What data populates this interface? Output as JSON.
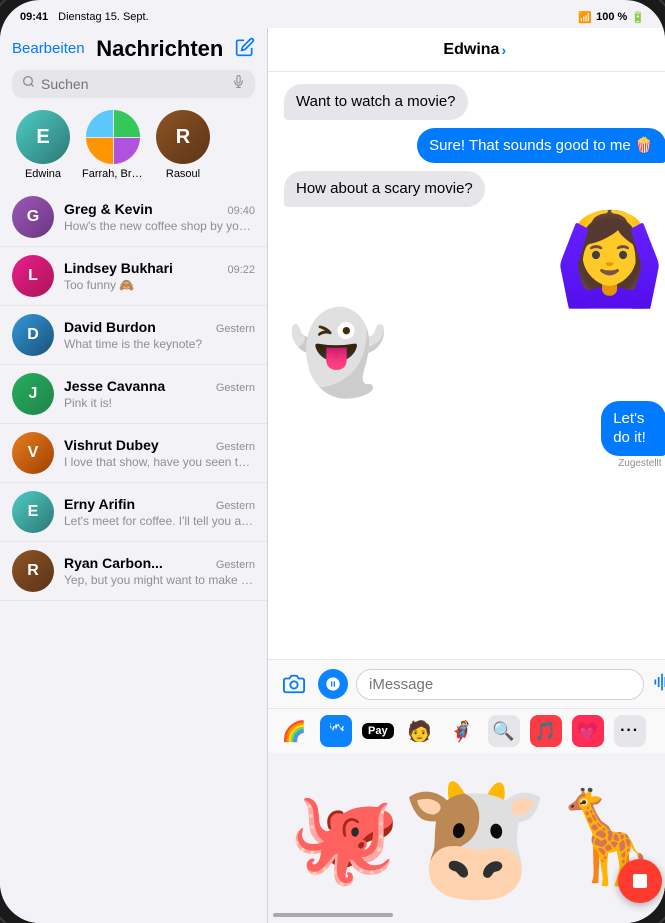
{
  "statusBar": {
    "time": "09:41",
    "date": "Dienstag 15. Sept.",
    "wifi": "WiFi",
    "battery": "100 %"
  },
  "sidebar": {
    "editLabel": "Bearbeiten",
    "title": "Nachrichten",
    "composeLabel": "✏",
    "search": {
      "placeholder": "Suchen"
    },
    "pinnedContacts": [
      {
        "id": "edwina",
        "name": "Edwina",
        "avatarColor": "av-teal",
        "initial": "E",
        "isGroup": false
      },
      {
        "id": "farrah-brya",
        "name": "Farrah, Brya...",
        "avatarColor": "",
        "initial": "",
        "isGroup": true
      },
      {
        "id": "rasoul",
        "name": "Rasoul",
        "avatarColor": "av-brown",
        "initial": "R",
        "isGroup": false
      }
    ],
    "conversations": [
      {
        "id": "greg-kevin",
        "name": "Greg & Kevin",
        "time": "09:40",
        "preview": "How's the new coffee shop by you guys?",
        "avatarColor": "av-purple",
        "initial": "G"
      },
      {
        "id": "lindsey",
        "name": "Lindsey Bukhari",
        "time": "09:22",
        "preview": "Too funny 🙈",
        "avatarColor": "av-pink",
        "initial": "L"
      },
      {
        "id": "david",
        "name": "David Burdon",
        "time": "Gestern",
        "preview": "What time is the keynote?",
        "avatarColor": "av-blue",
        "initial": "D"
      },
      {
        "id": "jesse",
        "name": "Jesse Cavanna",
        "time": "Gestern",
        "preview": "Pink it is!",
        "avatarColor": "av-green",
        "initial": "J"
      },
      {
        "id": "vishrut",
        "name": "Vishrut Dubey",
        "time": "Gestern",
        "preview": "I love that show, have you seen the latest episode? I...",
        "avatarColor": "av-orange",
        "initial": "V"
      },
      {
        "id": "erny",
        "name": "Erny Arifin",
        "time": "Gestern",
        "preview": "Let's meet for coffee. I'll tell you all about it.",
        "avatarColor": "av-teal",
        "initial": "E"
      },
      {
        "id": "ryan",
        "name": "Ryan Carbon...",
        "time": "Gestern",
        "preview": "Yep, but you might want to make it a surprise! Need...",
        "avatarColor": "av-brown",
        "initial": "R"
      }
    ]
  },
  "chat": {
    "contactName": "Edwina",
    "chevron": ">",
    "messages": [
      {
        "id": 1,
        "type": "incoming",
        "text": "Want to watch a movie?",
        "hasEmoji": false
      },
      {
        "id": 2,
        "type": "outgoing",
        "text": "Sure! That sounds good to me 🍿",
        "hasEmoji": false
      },
      {
        "id": 3,
        "type": "incoming",
        "text": "How about a scary movie?",
        "hasEmoji": false
      },
      {
        "id": 4,
        "type": "incoming-sticker",
        "emoji": "🧟‍♀️",
        "label": "memoji-scared"
      },
      {
        "id": 5,
        "type": "incoming-sticker",
        "emoji": "👻",
        "label": "ghost-sticker"
      },
      {
        "id": 6,
        "type": "outgoing",
        "text": "Let's do it!",
        "hasEmoji": false
      },
      {
        "id": 7,
        "type": "delivered",
        "text": "Zugestellt"
      }
    ],
    "inputPlaceholder": "iMessage",
    "deliveredLabel": "Zugestellt",
    "appStrip": [
      {
        "id": "photos",
        "emoji": "🌈",
        "label": "Photos"
      },
      {
        "id": "appstore",
        "emoji": "🅰",
        "label": "App Store",
        "bgColor": "#0D84FF"
      },
      {
        "id": "appay",
        "label": "Apple Pay",
        "isApplePay": true
      },
      {
        "id": "memoji1",
        "emoji": "👤",
        "label": "Memoji 1"
      },
      {
        "id": "memoji2",
        "emoji": "🦸",
        "label": "Memoji 2"
      },
      {
        "id": "search",
        "emoji": "🔍",
        "label": "Search",
        "bgColor": "#e5e5ea"
      },
      {
        "id": "music",
        "emoji": "🎵",
        "label": "Music",
        "bgColor": "#fc3c44"
      },
      {
        "id": "heart",
        "emoji": "💗",
        "label": "Health",
        "bgColor": "#ff2d55"
      },
      {
        "id": "more",
        "label": "...",
        "isMore": true
      }
    ]
  },
  "memojiPanel": {
    "items": [
      {
        "id": "octopus",
        "emoji": "🐙",
        "label": "Octopus Memoji"
      },
      {
        "id": "cow",
        "emoji": "🐮",
        "label": "Cow Memoji"
      },
      {
        "id": "giraffe",
        "emoji": "🦒",
        "label": "Giraffe Memoji"
      }
    ],
    "recordButton": {
      "label": "Record"
    }
  }
}
